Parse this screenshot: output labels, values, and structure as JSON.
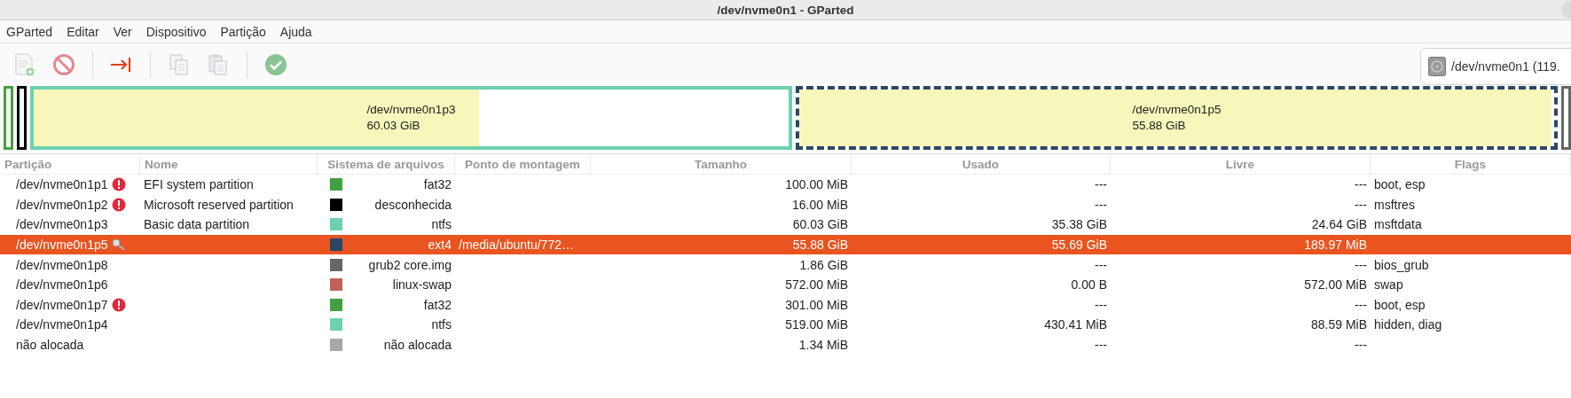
{
  "window": {
    "title": "/dev/nvme0n1 - GParted"
  },
  "menu": [
    "GParted",
    "Editar",
    "Ver",
    "Dispositivo",
    "Partição",
    "Ajuda"
  ],
  "toolbar": [
    {
      "kind": "new",
      "disabled": true
    },
    {
      "kind": "delete",
      "disabled": true
    },
    {
      "kind": "resize",
      "disabled": false
    },
    {
      "kind": "copy",
      "disabled": true
    },
    {
      "kind": "paste",
      "disabled": true
    },
    {
      "kind": "apply",
      "disabled": true
    }
  ],
  "device_selector": {
    "value": "/dev/nvme0n1 (119."
  },
  "partition_map": [
    {
      "kind": "sliver",
      "color": "#42a042"
    },
    {
      "kind": "sliver",
      "color": "#000000"
    },
    {
      "kind": "block",
      "color": "#6ed0b0",
      "selected": false,
      "name": "/dev/nvme0n1p3",
      "size": "60.03 GiB",
      "level": 0.59
    },
    {
      "kind": "block",
      "color": "#2c4766",
      "selected": true,
      "name": "/dev/nvme0n1p5",
      "size": "55.88 GiB",
      "level": 0.997
    },
    {
      "kind": "sliver",
      "color": "#666666"
    }
  ],
  "table": {
    "columns": [
      "Partição",
      "Nome",
      "Sistema de arquivos",
      "Ponto de montagem",
      "Tamanho",
      "Usado",
      "Livre",
      "Flags"
    ],
    "rows": [
      {
        "partition": "/dev/nvme0n1p1",
        "warning": true,
        "busy": false,
        "name": "EFI system partition",
        "color": "#42a042",
        "filesystem": "fat32",
        "mount": "",
        "size": "100.00 MiB",
        "used": "---",
        "free": "---",
        "flags": "boot, esp",
        "selected": false
      },
      {
        "partition": "/dev/nvme0n1p2",
        "warning": true,
        "busy": false,
        "name": "Microsoft reserved partition",
        "color": "#000000",
        "filesystem": "desconhecida",
        "mount": "",
        "size": "16.00 MiB",
        "used": "---",
        "free": "---",
        "flags": "msftres",
        "selected": false
      },
      {
        "partition": "/dev/nvme0n1p3",
        "warning": false,
        "busy": false,
        "name": "Basic data partition",
        "color": "#6ed0b0",
        "filesystem": "ntfs",
        "mount": "",
        "size": "60.03 GiB",
        "used": "35.38 GiB",
        "free": "24.64 GiB",
        "flags": "msftdata",
        "selected": false
      },
      {
        "partition": "/dev/nvme0n1p5",
        "warning": false,
        "busy": true,
        "name": "",
        "color": "#2c4766",
        "filesystem": "ext4",
        "mount": "/media/ubuntu/772…",
        "size": "55.88 GiB",
        "used": "55.69 GiB",
        "free": "189.97 MiB",
        "flags": "",
        "selected": true
      },
      {
        "partition": "/dev/nvme0n1p8",
        "warning": false,
        "busy": false,
        "name": "",
        "color": "#666666",
        "filesystem": "grub2 core.img",
        "mount": "",
        "size": "1.86 GiB",
        "used": "---",
        "free": "---",
        "flags": "bios_grub",
        "selected": false
      },
      {
        "partition": "/dev/nvme0n1p6",
        "warning": false,
        "busy": false,
        "name": "",
        "color": "#c0635a",
        "filesystem": "linux-swap",
        "mount": "",
        "size": "572.00 MiB",
        "used": "0.00 B",
        "free": "572.00 MiB",
        "flags": "swap",
        "selected": false
      },
      {
        "partition": "/dev/nvme0n1p7",
        "warning": true,
        "busy": false,
        "name": "",
        "color": "#42a042",
        "filesystem": "fat32",
        "mount": "",
        "size": "301.00 MiB",
        "used": "---",
        "free": "---",
        "flags": "boot, esp",
        "selected": false
      },
      {
        "partition": "/dev/nvme0n1p4",
        "warning": false,
        "busy": false,
        "name": "",
        "color": "#6ed0b0",
        "filesystem": "ntfs",
        "mount": "",
        "size": "519.00 MiB",
        "used": "430.41 MiB",
        "free": "88.59 MiB",
        "flags": "hidden, diag",
        "selected": false
      },
      {
        "partition": "não alocada",
        "warning": false,
        "busy": false,
        "name": "",
        "color": "#a8a8a8",
        "filesystem": "não alocada",
        "mount": "",
        "size": "1.34 MiB",
        "used": "---",
        "free": "---",
        "flags": "",
        "selected": false
      }
    ]
  }
}
